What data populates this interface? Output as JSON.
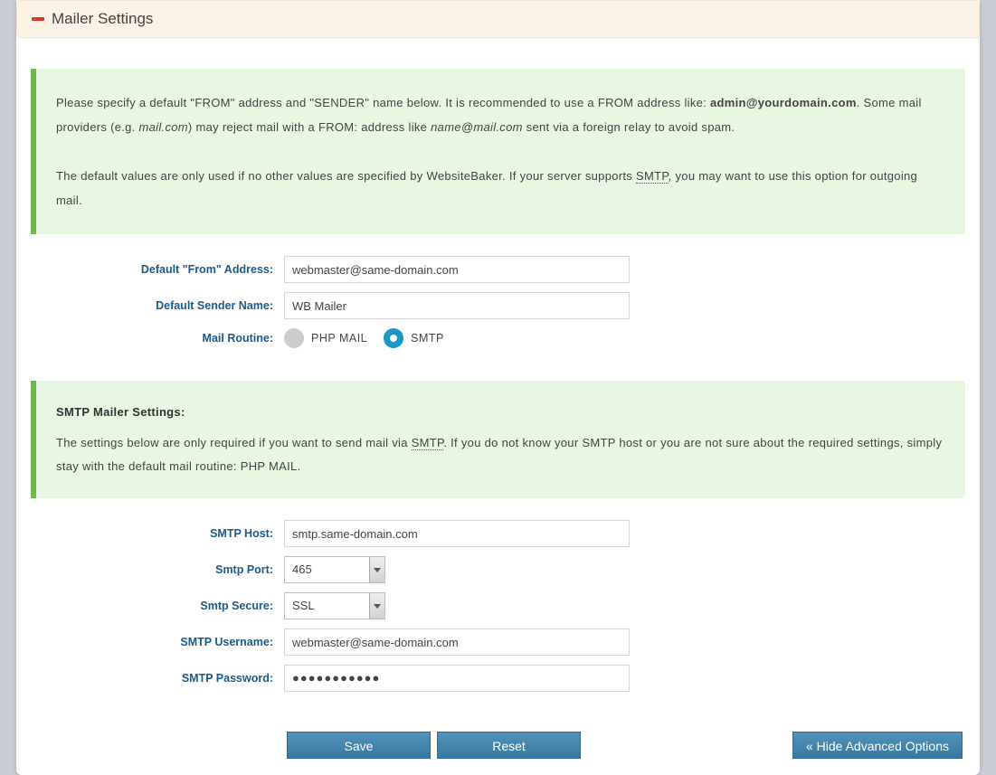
{
  "header": {
    "title": "Mailer Settings"
  },
  "info1": {
    "t1": "Please specify a default \"FROM\" address and \"SENDER\" name below. It is recommended to use a FROM address like: ",
    "bold1": "admin@yourdomain.com",
    "t2": ". Some mail providers (e.g. ",
    "it1": "mail.com",
    "t3": ") may reject mail with a FROM: address like ",
    "it2": "name@mail.com",
    "t4": " sent via a foreign relay to avoid spam."
  },
  "info2": {
    "t1": "The default values are only used if no other values are specified by WebsiteBaker. If your server supports ",
    "abbr": "SMTP",
    "t2": ", you may want to use this option for outgoing mail."
  },
  "labels": {
    "from": "Default \"From\" Address:",
    "sender": "Default Sender Name:",
    "routine": "Mail Routine:",
    "smtp_host": "SMTP Host:",
    "smtp_port": "Smtp Port:",
    "smtp_secure": "Smtp Secure:",
    "smtp_user": "SMTP Username:",
    "smtp_pass": "SMTP Password:"
  },
  "values": {
    "from": "webmaster@same-domain.com",
    "sender": "WB Mailer",
    "php_mail": "PHP MAIL",
    "smtp": "SMTP",
    "smtp_host": "smtp.same-domain.com",
    "smtp_port": "465",
    "smtp_secure": "SSL",
    "smtp_user": "webmaster@same-domain.com",
    "smtp_pass": "●●●●●●●●●●●"
  },
  "smtp_info": {
    "heading": "SMTP Mailer Settings:",
    "t1": "The settings below are only required if you want to send mail via ",
    "abbr": "SMTP",
    "t2": ". If you do not know your SMTP host or you are not sure about the required settings, simply stay with the default mail routine: PHP MAIL."
  },
  "buttons": {
    "save": "Save",
    "reset": "Reset",
    "hide": "« Hide Advanced Options"
  }
}
